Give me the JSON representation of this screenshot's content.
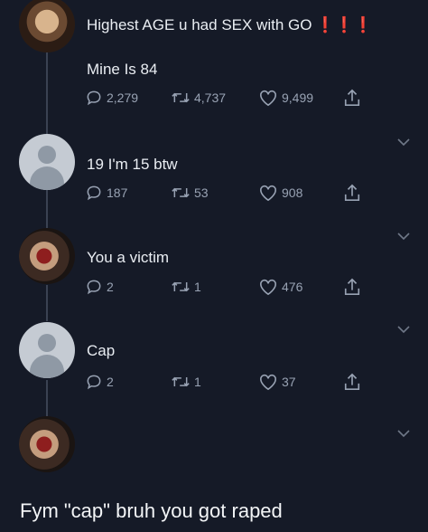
{
  "thread": [
    {
      "text": "Highest AGE u had SEX with GO",
      "emoji": "❗❗❗",
      "reply": "Mine Is 84",
      "replies": "2,279",
      "retweets": "4,737",
      "likes": "9,499"
    },
    {
      "text": "19 I'm 15 btw",
      "replies": "187",
      "retweets": "53",
      "likes": "908"
    },
    {
      "text": "You a victim",
      "replies": "2",
      "retweets": "1",
      "likes": "476"
    },
    {
      "text": "Cap",
      "replies": "2",
      "retweets": "1",
      "likes": "37"
    }
  ],
  "caption": "Fym \"cap\" bruh you got raped",
  "icons": {
    "reply": "reply-icon",
    "retweet": "retweet-icon",
    "like": "heart-icon",
    "share": "share-icon",
    "more": "chevron-down-icon"
  }
}
